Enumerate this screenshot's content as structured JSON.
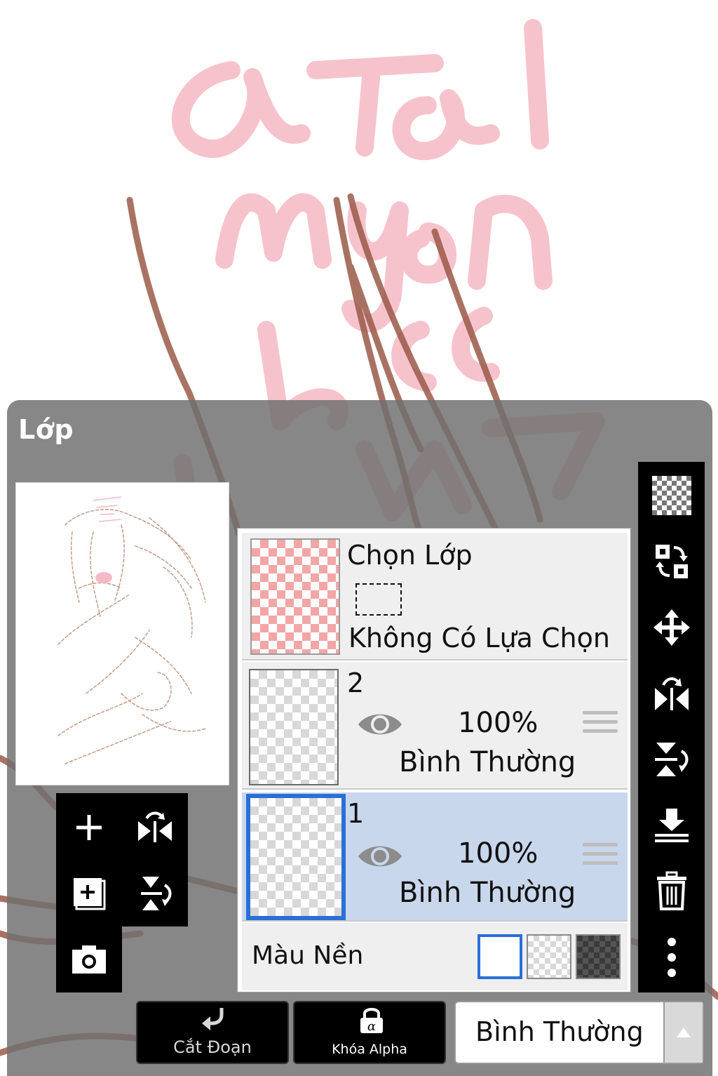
{
  "panel": {
    "title": "Lớp"
  },
  "layers": [
    {
      "name": "Chọn Lớp",
      "sub": "Không Có Lựa Chọn"
    },
    {
      "name": "2",
      "opacity": "100%",
      "blend": "Bình Thường",
      "visible": true
    },
    {
      "name": "1",
      "opacity": "100%",
      "blend": "Bình Thường",
      "visible": true,
      "selected": true
    }
  ],
  "background": {
    "label": "Màu Nền",
    "options": [
      "white",
      "transparent",
      "dark-checker"
    ],
    "selected": "white"
  },
  "bottom_bar": {
    "clip_label": "Cắt Đoạn",
    "alpha_lock_label": "Khóa Alpha",
    "blend_mode_value": "Bình Thường"
  },
  "colors": {
    "selection_border": "#2a6fd6",
    "selected_row": "#c9d7ec",
    "panel_bg": "#707070",
    "toolbar_bg": "#000000"
  },
  "icons": {
    "left_tools": [
      "add-layer-icon",
      "flip-horizontal-icon",
      "add-copy-layer-icon",
      "flip-vertical-icon",
      "camera-icon"
    ],
    "right_tools": [
      "transparent-checker-icon",
      "swap-layer-icon",
      "move-icon",
      "flip-horizontal-icon",
      "flip-vertical-icon",
      "merge-down-icon",
      "trash-icon",
      "more-vertical-icon"
    ]
  }
}
